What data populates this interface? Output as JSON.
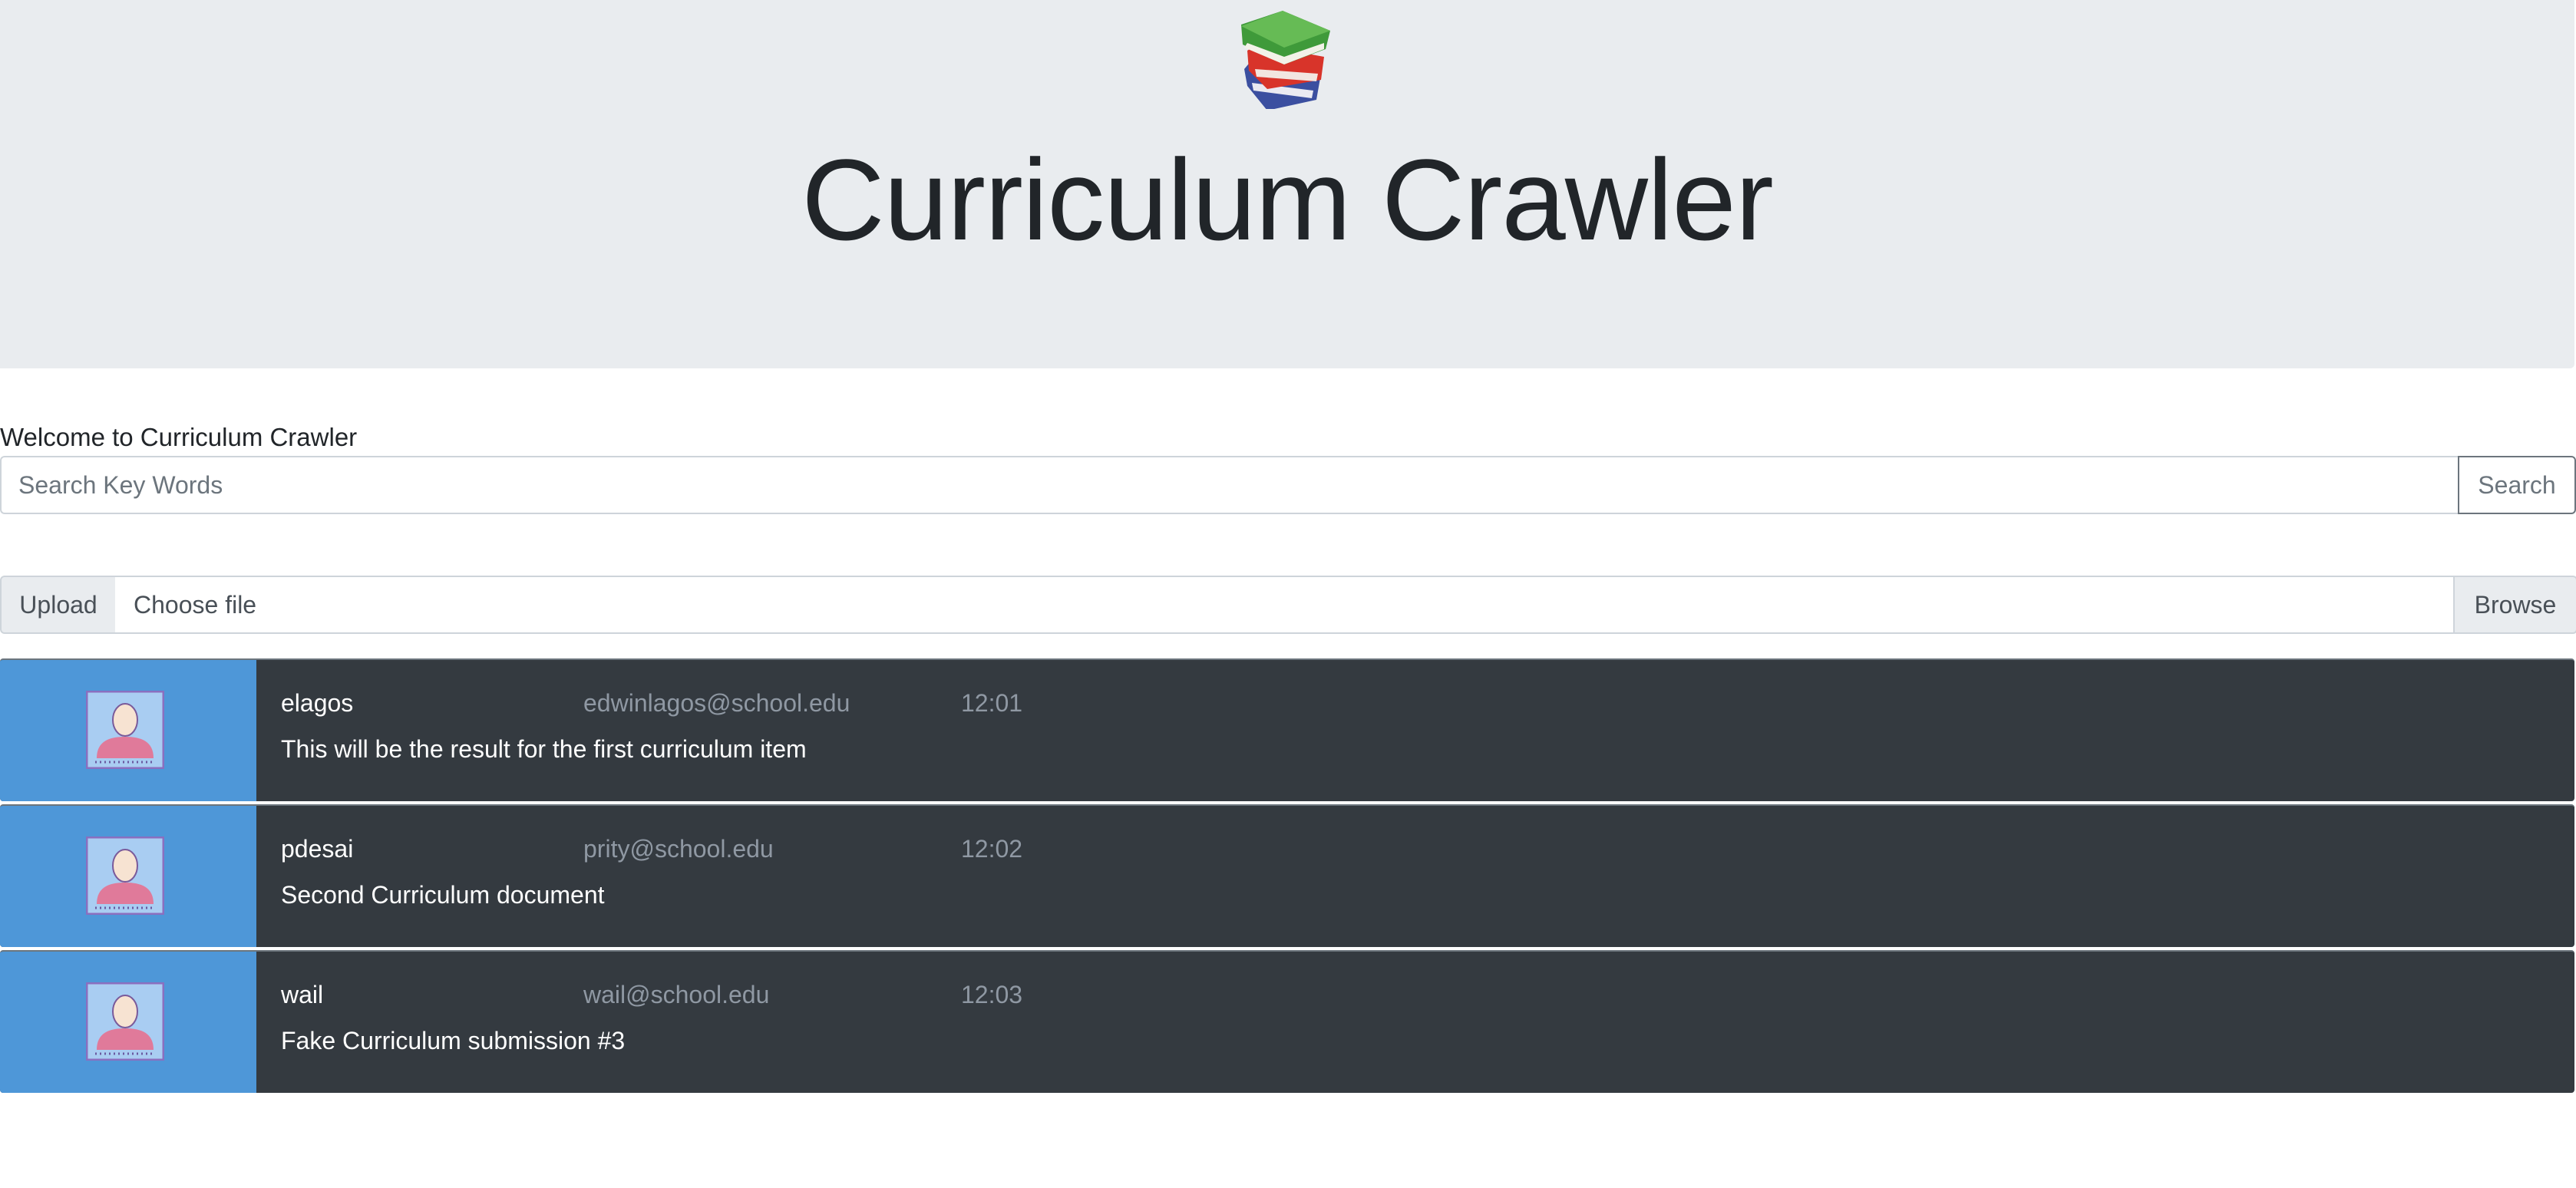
{
  "header": {
    "logo_icon": "books-icon",
    "title": "Curriculum Crawler"
  },
  "welcome_text": "Welcome to Curriculum Crawler",
  "search": {
    "placeholder": "Search Key Words",
    "button_label": "Search"
  },
  "upload": {
    "label": "Upload",
    "file_text": "Choose file",
    "browse_label": "Browse"
  },
  "results": [
    {
      "username": "elagos",
      "email": "edwinlagos@school.edu",
      "time": "12:01",
      "description": "This will be the result for the first curriculum item"
    },
    {
      "username": "pdesai",
      "email": "prity@school.edu",
      "time": "12:02",
      "description": "Second Curriculum document"
    },
    {
      "username": "wail",
      "email": "wail@school.edu",
      "time": "12:03",
      "description": "Fake Curriculum submission #3"
    }
  ],
  "colors": {
    "hero_bg": "#e9ecef",
    "result_bg": "#343a40",
    "avatar_bg": "#4e97d8"
  }
}
